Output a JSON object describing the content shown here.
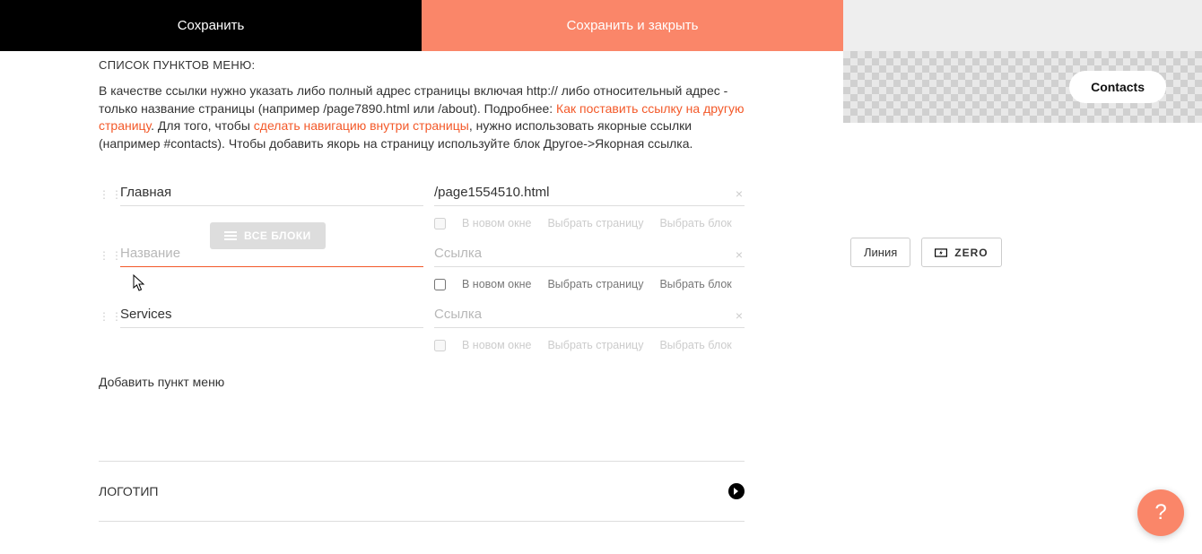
{
  "header": {
    "save": "Сохранить",
    "save_close": "Сохранить и закрыть"
  },
  "section_title": "СПИСОК ПУНКТОВ МЕНЮ:",
  "help": {
    "t1": "В качестве ссылки нужно указать либо полный адрес страницы включая http:// либо относительный адрес - только название страницы (например /page7890.html или /about). Подробнее: ",
    "link1": "Как поставить ссылку на другую страницу",
    "t2": ". Для того, чтобы ",
    "link2": "сделать навигацию внутри страницы",
    "t3": ", нужно использовать якорные ссылки (например #contacts). Чтобы добавить якорь на страницу используйте блок Другое->Якорная ссылка."
  },
  "placeholders": {
    "name": "Название",
    "link": "Ссылка"
  },
  "rows": [
    {
      "name": "Главная",
      "link": "/page1554510.html",
      "active": false,
      "sub_disabled": true
    },
    {
      "name": "",
      "link": "",
      "active": true,
      "sub_disabled": false
    },
    {
      "name": "Services",
      "link": "",
      "active": false,
      "sub_disabled": true
    }
  ],
  "sub": {
    "newwin": "В новом окне",
    "choose_page": "Выбрать страницу",
    "choose_block": "Выбрать блок"
  },
  "add_item": "Добавить пункт меню",
  "logo_section": "ЛОГОТИП",
  "floating": "ВСЕ БЛОКИ",
  "preview": {
    "contacts": "Contacts",
    "line": "Линия",
    "zero": "ZERO"
  },
  "help_fab": "?"
}
